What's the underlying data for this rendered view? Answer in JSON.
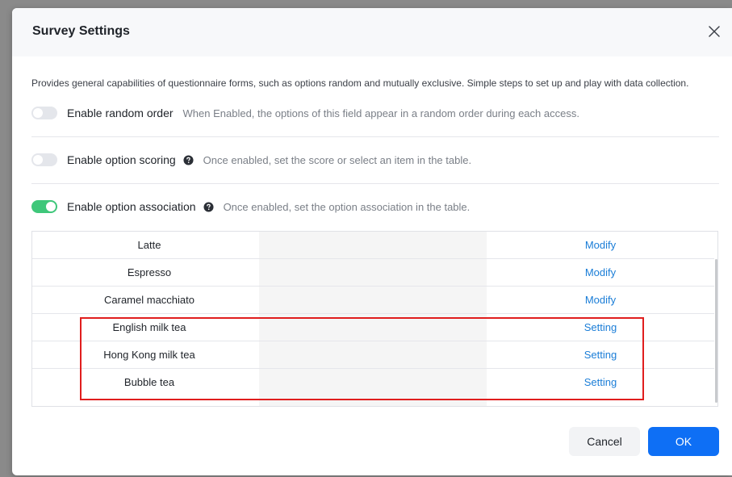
{
  "dialog": {
    "title": "Survey Settings",
    "description": "Provides general capabilities of questionnaire forms, such as options random and mutually exclusive. Simple steps to set up and play with data collection."
  },
  "options": [
    {
      "label": "Enable random order",
      "hint": "When Enabled, the options of this field appear in a random order during each access.",
      "enabled": false,
      "has_help": false
    },
    {
      "label": "Enable option scoring",
      "hint": "Once enabled, set the score or select an item in the table.",
      "enabled": false,
      "has_help": true
    },
    {
      "label": "Enable option association",
      "hint": "Once enabled, set the option association in the table.",
      "enabled": true,
      "has_help": true
    }
  ],
  "table": {
    "rows": [
      {
        "name": "Latte",
        "association": "",
        "action": "Modify"
      },
      {
        "name": "Espresso",
        "association": "",
        "action": "Modify"
      },
      {
        "name": "Caramel macchiato",
        "association": "",
        "action": "Modify"
      },
      {
        "name": "English milk tea",
        "association": "",
        "action": "Setting"
      },
      {
        "name": "Hong Kong milk tea",
        "association": "",
        "action": "Setting"
      },
      {
        "name": "Bubble tea",
        "association": "",
        "action": "Setting"
      }
    ]
  },
  "footer": {
    "cancel_label": "Cancel",
    "ok_label": "OK"
  },
  "colors": {
    "accent": "#0e6ff5",
    "link": "#1a7dd7",
    "toggle_on": "#3fc77a",
    "highlight": "#e01e1e"
  }
}
